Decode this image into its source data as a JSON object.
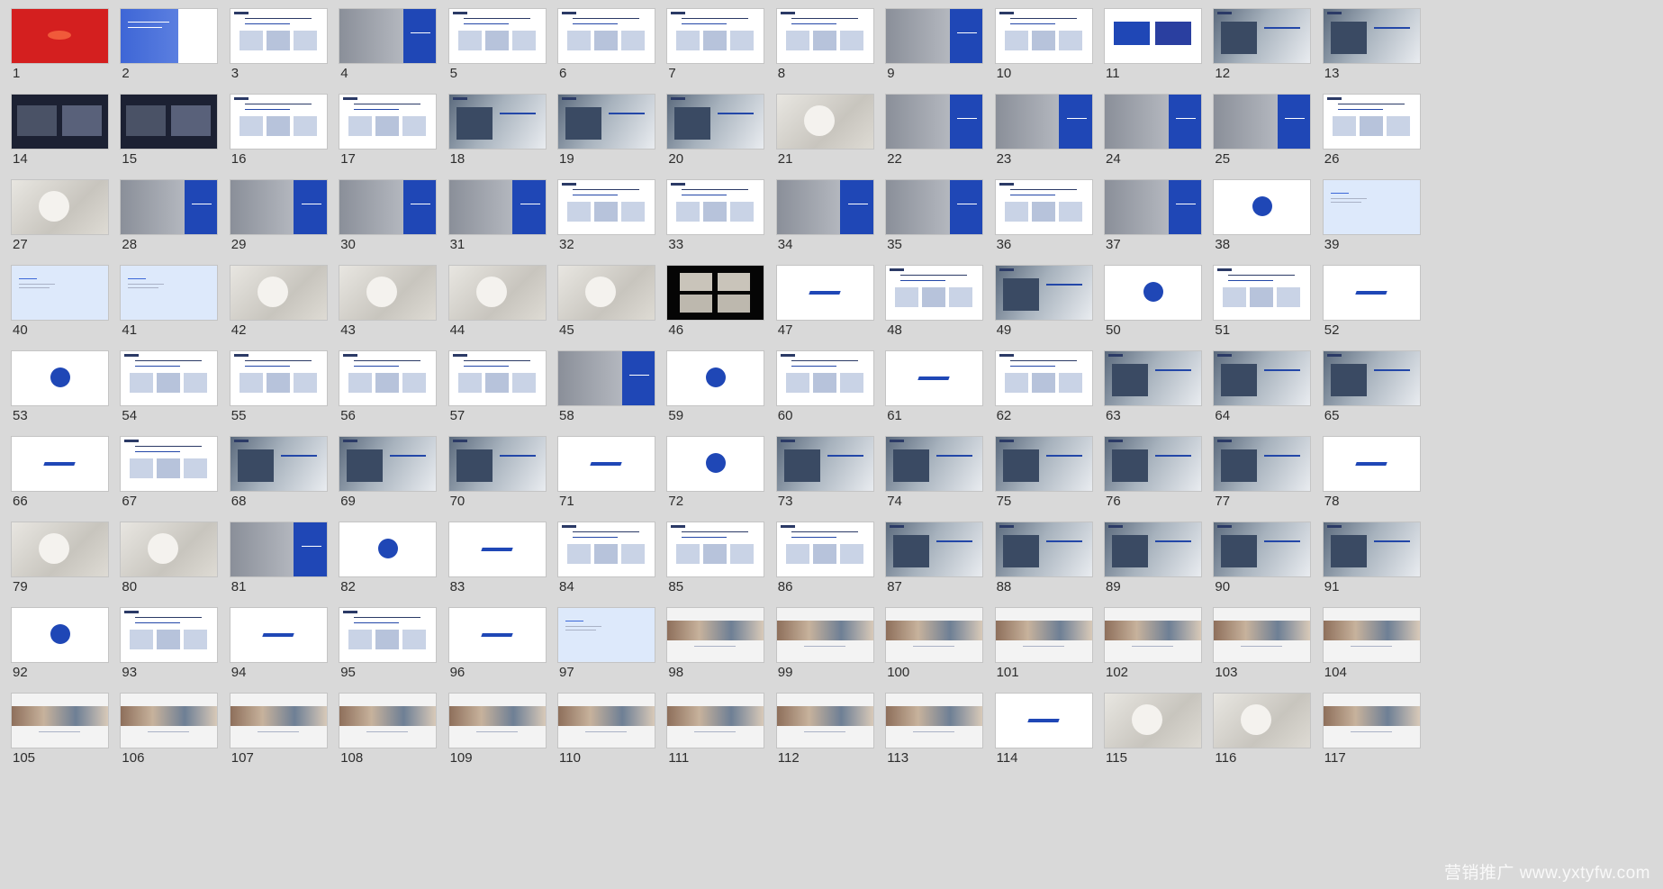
{
  "app": "Slide Sorter",
  "layout_cols": 13,
  "slides": [
    {
      "n": "1",
      "kind": "red"
    },
    {
      "n": "2",
      "kind": "bluecover"
    },
    {
      "n": "3",
      "kind": "text"
    },
    {
      "n": "4",
      "kind": "panel"
    },
    {
      "n": "5",
      "kind": "text"
    },
    {
      "n": "6",
      "kind": "text"
    },
    {
      "n": "7",
      "kind": "text"
    },
    {
      "n": "8",
      "kind": "text"
    },
    {
      "n": "9",
      "kind": "panel"
    },
    {
      "n": "10",
      "kind": "text"
    },
    {
      "n": "11",
      "kind": "bluebox"
    },
    {
      "n": "12",
      "kind": "photo"
    },
    {
      "n": "13",
      "kind": "photo"
    },
    {
      "n": "14",
      "kind": "dark"
    },
    {
      "n": "15",
      "kind": "dark"
    },
    {
      "n": "16",
      "kind": "text"
    },
    {
      "n": "17",
      "kind": "text"
    },
    {
      "n": "18",
      "kind": "photo"
    },
    {
      "n": "19",
      "kind": "photo"
    },
    {
      "n": "20",
      "kind": "photo"
    },
    {
      "n": "21",
      "kind": "grey"
    },
    {
      "n": "22",
      "kind": "panel"
    },
    {
      "n": "23",
      "kind": "panel"
    },
    {
      "n": "24",
      "kind": "panel"
    },
    {
      "n": "25",
      "kind": "panel"
    },
    {
      "n": "26",
      "kind": "text"
    },
    {
      "n": "27",
      "kind": "grey"
    },
    {
      "n": "28",
      "kind": "panel"
    },
    {
      "n": "29",
      "kind": "panel"
    },
    {
      "n": "30",
      "kind": "panel"
    },
    {
      "n": "31",
      "kind": "panel"
    },
    {
      "n": "32",
      "kind": "text"
    },
    {
      "n": "33",
      "kind": "text"
    },
    {
      "n": "34",
      "kind": "panel"
    },
    {
      "n": "35",
      "kind": "panel"
    },
    {
      "n": "36",
      "kind": "text"
    },
    {
      "n": "37",
      "kind": "panel"
    },
    {
      "n": "38",
      "kind": "circle"
    },
    {
      "n": "39",
      "kind": "lightblue"
    },
    {
      "n": "40",
      "kind": "lightblue"
    },
    {
      "n": "41",
      "kind": "lightblue"
    },
    {
      "n": "42",
      "kind": "grey"
    },
    {
      "n": "43",
      "kind": "grey"
    },
    {
      "n": "44",
      "kind": "grey"
    },
    {
      "n": "45",
      "kind": "grey"
    },
    {
      "n": "46",
      "kind": "black"
    },
    {
      "n": "47",
      "kind": "bar"
    },
    {
      "n": "48",
      "kind": "text"
    },
    {
      "n": "49",
      "kind": "photo"
    },
    {
      "n": "50",
      "kind": "circle"
    },
    {
      "n": "51",
      "kind": "text"
    },
    {
      "n": "52",
      "kind": "bar"
    },
    {
      "n": "53",
      "kind": "circle"
    },
    {
      "n": "54",
      "kind": "text"
    },
    {
      "n": "55",
      "kind": "text"
    },
    {
      "n": "56",
      "kind": "text"
    },
    {
      "n": "57",
      "kind": "text"
    },
    {
      "n": "58",
      "kind": "panel"
    },
    {
      "n": "59",
      "kind": "circle"
    },
    {
      "n": "60",
      "kind": "text"
    },
    {
      "n": "61",
      "kind": "bar"
    },
    {
      "n": "62",
      "kind": "text"
    },
    {
      "n": "63",
      "kind": "photo"
    },
    {
      "n": "64",
      "kind": "photo"
    },
    {
      "n": "65",
      "kind": "photo"
    },
    {
      "n": "66",
      "kind": "bar"
    },
    {
      "n": "67",
      "kind": "text"
    },
    {
      "n": "68",
      "kind": "photo"
    },
    {
      "n": "69",
      "kind": "photo"
    },
    {
      "n": "70",
      "kind": "photo"
    },
    {
      "n": "71",
      "kind": "bar"
    },
    {
      "n": "72",
      "kind": "circle"
    },
    {
      "n": "73",
      "kind": "photo"
    },
    {
      "n": "74",
      "kind": "photo"
    },
    {
      "n": "75",
      "kind": "photo"
    },
    {
      "n": "76",
      "kind": "photo"
    },
    {
      "n": "77",
      "kind": "photo"
    },
    {
      "n": "78",
      "kind": "bar"
    },
    {
      "n": "79",
      "kind": "grey"
    },
    {
      "n": "80",
      "kind": "grey"
    },
    {
      "n": "81",
      "kind": "panel"
    },
    {
      "n": "82",
      "kind": "circle"
    },
    {
      "n": "83",
      "kind": "bar"
    },
    {
      "n": "84",
      "kind": "text"
    },
    {
      "n": "85",
      "kind": "text"
    },
    {
      "n": "86",
      "kind": "text"
    },
    {
      "n": "87",
      "kind": "photo"
    },
    {
      "n": "88",
      "kind": "photo"
    },
    {
      "n": "89",
      "kind": "photo"
    },
    {
      "n": "90",
      "kind": "photo"
    },
    {
      "n": "91",
      "kind": "photo"
    },
    {
      "n": "92",
      "kind": "circle"
    },
    {
      "n": "93",
      "kind": "text"
    },
    {
      "n": "94",
      "kind": "bar"
    },
    {
      "n": "95",
      "kind": "text"
    },
    {
      "n": "96",
      "kind": "bar"
    },
    {
      "n": "97",
      "kind": "lightblue"
    },
    {
      "n": "98",
      "kind": "strip"
    },
    {
      "n": "99",
      "kind": "strip"
    },
    {
      "n": "100",
      "kind": "strip"
    },
    {
      "n": "101",
      "kind": "strip"
    },
    {
      "n": "102",
      "kind": "strip"
    },
    {
      "n": "103",
      "kind": "strip"
    },
    {
      "n": "104",
      "kind": "strip"
    },
    {
      "n": "105",
      "kind": "strip"
    },
    {
      "n": "106",
      "kind": "strip"
    },
    {
      "n": "107",
      "kind": "strip"
    },
    {
      "n": "108",
      "kind": "strip"
    },
    {
      "n": "109",
      "kind": "strip"
    },
    {
      "n": "110",
      "kind": "strip"
    },
    {
      "n": "111",
      "kind": "strip"
    },
    {
      "n": "112",
      "kind": "strip"
    },
    {
      "n": "113",
      "kind": "strip"
    },
    {
      "n": "114",
      "kind": "bar"
    },
    {
      "n": "115",
      "kind": "grey"
    },
    {
      "n": "116",
      "kind": "grey"
    },
    {
      "n": "117",
      "kind": "strip"
    }
  ],
  "watermark": "营销推广 www.yxtyfw.com",
  "colors": {
    "background": "#d9d9d9",
    "brand_blue": "#1f47b6",
    "red": "#d41f1f",
    "text": "#2d2d2d"
  }
}
